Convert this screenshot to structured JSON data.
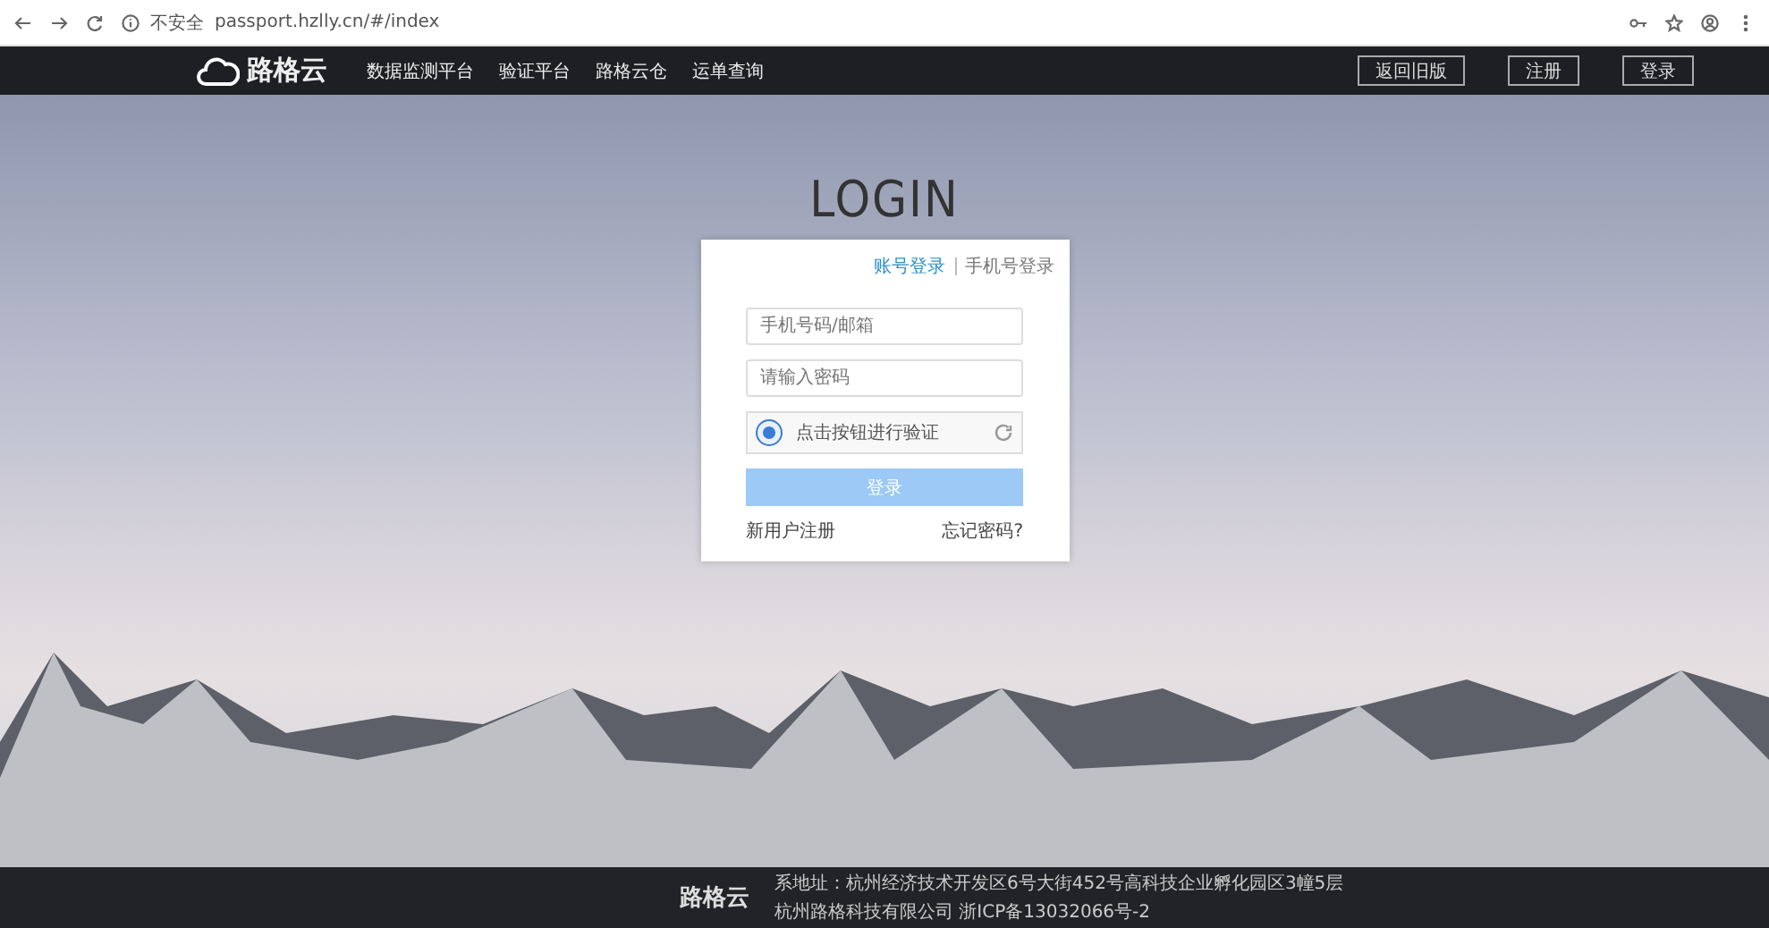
{
  "browser": {
    "security": "不安全",
    "url": "passport.hzlly.cn/#/index"
  },
  "navbar": {
    "logo": "路格云",
    "links": [
      "数据监测平台",
      "验证平台",
      "路格云仓",
      "运单查询"
    ],
    "buttons": [
      "返回旧版",
      "注册",
      "登录"
    ]
  },
  "hero": {
    "title": "LOGIN"
  },
  "login": {
    "tabs": [
      {
        "label": "账号登录",
        "selected": true
      },
      {
        "label": "手机号登录",
        "selected": false
      }
    ],
    "fields": [
      {
        "placeholder": "手机号码/邮箱"
      },
      {
        "placeholder": "请输入密码"
      }
    ],
    "captcha": "点击按钮进行验证",
    "submit": "登录",
    "register": "新用户注册",
    "forgot": "忘记密码?"
  },
  "footer": {
    "logo": "路格云",
    "lines": [
      "系地址：杭州经济技术开发区6号大街452号高科技企业孵化园区3幢5层",
      "杭州路格科技有限公司 浙ICP备13032066号-2"
    ]
  }
}
